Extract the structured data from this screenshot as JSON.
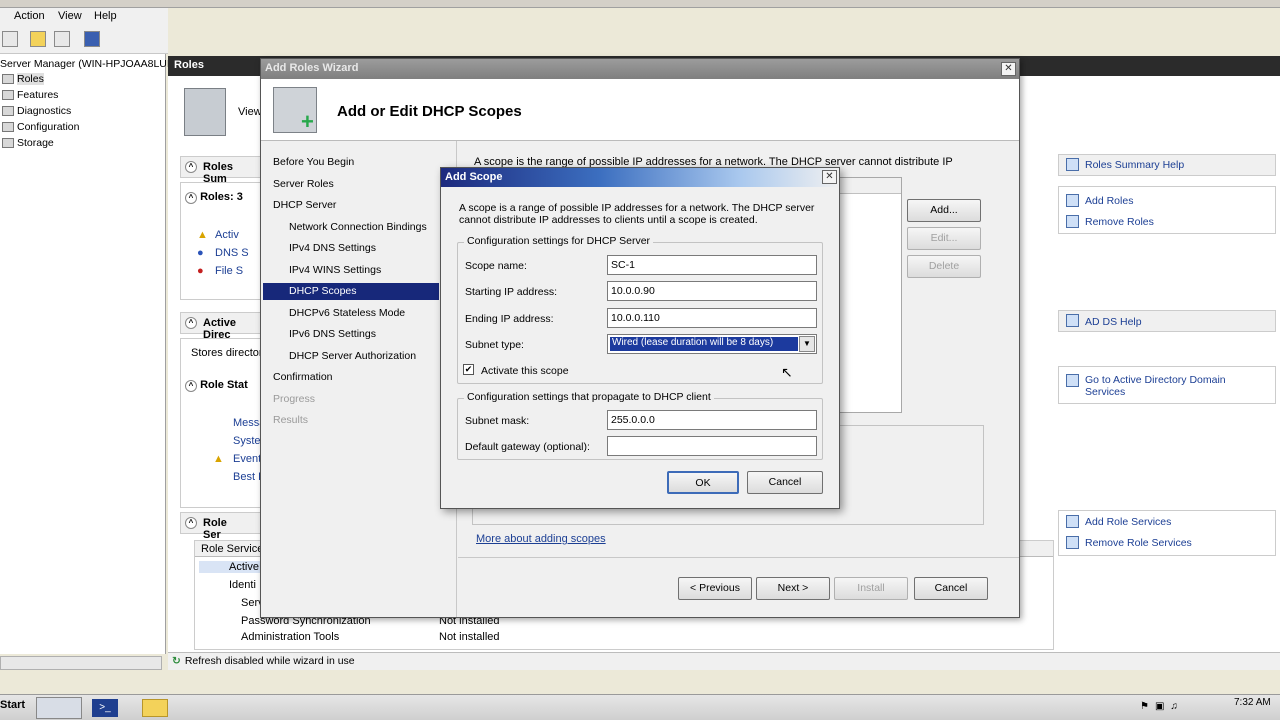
{
  "host_menu": [
    "Action",
    "View",
    "Help"
  ],
  "tree": {
    "root": "Server Manager (WIN-HPJOAA8LUI",
    "items": [
      "Roles",
      "Features",
      "Diagnostics",
      "Configuration",
      "Storage"
    ]
  },
  "main": {
    "title": "Roles",
    "view_text": "View",
    "roles_summary": "Roles Sum",
    "roles_label": "Roles: 3",
    "role_rows": [
      "Activ",
      "DNS S",
      "File S"
    ],
    "active_directory": "Active Direc",
    "stores_text": "Stores director",
    "role_status": "Role Stat",
    "status_links": [
      "Messa",
      "Syste",
      "Event",
      "Best P"
    ],
    "role_services": "Role Ser",
    "role_services_header": "Role Service",
    "role_services_rows": [
      {
        "name": "Active",
        "status": ""
      },
      {
        "name": "Identi",
        "status": ""
      },
      {
        "name": "Serv",
        "status": ""
      },
      {
        "name": "Password Synchronization",
        "status": "Not installed"
      },
      {
        "name": "Administration Tools",
        "status": "Not installed"
      }
    ]
  },
  "right_panel": {
    "roles_summary_help": "Roles Summary Help",
    "add_roles": "Add Roles",
    "remove_roles": "Remove Roles",
    "ad_ds_help": "AD DS Help",
    "goto_ad": "Go to Active Directory Domain Services",
    "add_role_services": "Add Role Services",
    "remove_role_services": "Remove Role Services"
  },
  "wizard": {
    "title": "Add Roles Wizard",
    "heading": "Add or Edit DHCP Scopes",
    "nav": [
      {
        "label": "Before You Begin",
        "level": 0,
        "state": "normal"
      },
      {
        "label": "Server Roles",
        "level": 0,
        "state": "normal"
      },
      {
        "label": "DHCP Server",
        "level": 0,
        "state": "normal"
      },
      {
        "label": "Network Connection Bindings",
        "level": 1,
        "state": "normal"
      },
      {
        "label": "IPv4 DNS Settings",
        "level": 1,
        "state": "normal"
      },
      {
        "label": "IPv4 WINS Settings",
        "level": 1,
        "state": "normal"
      },
      {
        "label": "DHCP Scopes",
        "level": 1,
        "state": "active"
      },
      {
        "label": "DHCPv6 Stateless Mode",
        "level": 1,
        "state": "normal"
      },
      {
        "label": "IPv6 DNS Settings",
        "level": 1,
        "state": "normal"
      },
      {
        "label": "DHCP Server Authorization",
        "level": 1,
        "state": "normal"
      },
      {
        "label": "Confirmation",
        "level": 0,
        "state": "normal"
      },
      {
        "label": "Progress",
        "level": 0,
        "state": "dim"
      },
      {
        "label": "Results",
        "level": 0,
        "state": "dim"
      }
    ],
    "intro": "A scope is the range of possible IP addresses for a network. The DHCP server cannot distribute IP",
    "add_btn": "Add...",
    "edit_btn": "Edit...",
    "delete_btn": "Delete",
    "more_link": "More about adding scopes",
    "prev_btn": "< Previous",
    "next_btn": "Next >",
    "install_btn": "Install",
    "cancel_btn": "Cancel"
  },
  "scope_dialog": {
    "title": "Add Scope",
    "description": "A scope is a range of possible IP addresses for a network. The DHCP server cannot distribute IP addresses to clients until a scope is created.",
    "group1_title": "Configuration settings for DHCP Server",
    "scope_name_label": "Scope name:",
    "scope_name_value": "SC-1",
    "start_ip_label": "Starting IP address:",
    "start_ip_value": "10.0.0.90",
    "end_ip_label": "Ending IP address:",
    "end_ip_value": "10.0.0.110",
    "subnet_type_label": "Subnet type:",
    "subnet_type_value": "Wired (lease duration will be 8 days)",
    "activate_label": "Activate this scope",
    "activate_checked": true,
    "group2_title": "Configuration settings that propagate to DHCP client",
    "subnet_mask_label": "Subnet mask:",
    "subnet_mask_value": "255.0.0.0",
    "gateway_label": "Default gateway (optional):",
    "gateway_value": "",
    "ok_btn": "OK",
    "cancel_btn": "Cancel"
  },
  "status_bar": "Refresh disabled while wizard in use",
  "taskbar": {
    "start": "Start",
    "time": "7:32 AM"
  }
}
